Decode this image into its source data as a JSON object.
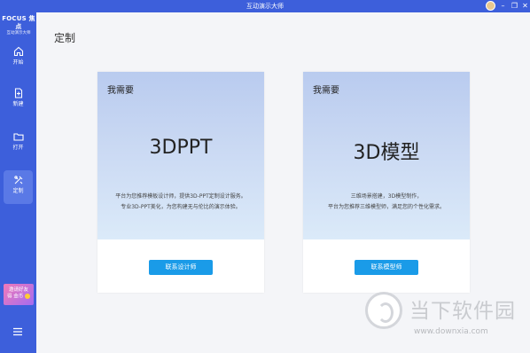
{
  "window": {
    "title": "互动演示大师",
    "controls": {
      "minimize": "–",
      "maximize": "❐",
      "close": "✕"
    }
  },
  "sidebar": {
    "logo_main": "FOCUS 焦点",
    "logo_sub": "互动演示大师",
    "items": [
      {
        "icon": "home-icon",
        "label": "开始"
      },
      {
        "icon": "new-file-icon",
        "label": "新建"
      },
      {
        "icon": "folder-icon",
        "label": "打开"
      },
      {
        "icon": "customize-icon",
        "label": "定制",
        "active": true
      }
    ],
    "invite": {
      "line1": "邀请好友",
      "line2": "得",
      "line3": "金币"
    },
    "menu_icon": "hamburger-icon"
  },
  "main": {
    "title": "定制",
    "cards": [
      {
        "need": "我需要",
        "big": "3DPPT",
        "desc1": "平台为您推荐模板设计师，提供3D-PPT定制设计服务。",
        "desc2": "专业3D-PPT美化，为您构建无与伦比的演示体验。",
        "button": "联系设计师"
      },
      {
        "need": "我需要",
        "big": "3D模型",
        "desc1": "三维场景搭建，3D模型制作，",
        "desc2": "平台为您推荐三维模型师，满足您的个性化需求。",
        "button": "联系模型师"
      }
    ]
  },
  "watermark": {
    "name": "当下软件园",
    "url": "www.downxia.com"
  },
  "colors": {
    "brand": "#3d5fdb",
    "button": "#1a9be8",
    "card_gradient_top": "#b9cbef",
    "card_gradient_bottom": "#dbeaf9"
  }
}
